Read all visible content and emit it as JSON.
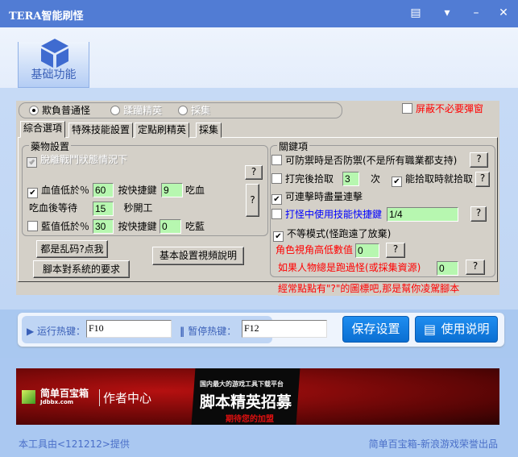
{
  "window": {
    "title": "TERA智能刷怪"
  },
  "nav": {
    "tab_label": "基础功能"
  },
  "mode": {
    "options": [
      "欺負普通怪",
      "蹂躪精英",
      "採集"
    ],
    "selected": 0,
    "block_popups_label": "屏蔽不必要彈窗",
    "block_popups_checked": false
  },
  "tabs": [
    "綜合選項",
    "特殊技能設置",
    "定點刷精英",
    "採集"
  ],
  "potion": {
    "legend": "藥物設置",
    "out_of_combat_label": "脫離戰鬥狀態情況下",
    "hp_label": "血值低於％",
    "hp_checked": true,
    "hp_value": "60",
    "hotkey_label": "按快捷鍵",
    "hp_key": "9",
    "hp_suffix": "吃血",
    "wait_label": "吃血後等待",
    "wait_value": "15",
    "wait_suffix": "秒開工",
    "mp_label": "藍值低於％",
    "mp_checked": false,
    "mp_value": "30",
    "mp_key": "0",
    "mp_suffix": "吃藍",
    "help": "?"
  },
  "buttons": {
    "garbled": "都是乱码?点我",
    "requirements": "腳本對系統的要求",
    "video": "基本設置視頻說明"
  },
  "key": {
    "legend": "關鍵項",
    "defend_label": "可防禦時是否防禦(不是所有職業都支持)",
    "defend_checked": false,
    "loot_after_label": "打完後拾取",
    "loot_after_checked": false,
    "loot_after_value": "3",
    "loot_after_unit": "次",
    "loot_asap_label": "能拾取時就拾取",
    "loot_asap_checked": true,
    "combo_label": "可連擊時盡量連擊",
    "combo_checked": true,
    "skill_key_label": "打怪中使用技能快捷鍵",
    "skill_key_checked": false,
    "skill_key_value": "1/4",
    "no_wait_label": "不等模式(怪跑遠了放棄)",
    "no_wait_checked": true,
    "camera_label": "角色視角高低數值",
    "camera_value": "0",
    "stuck_label": "如果人物總是跑過怪(或採集資源)",
    "stuck_value": "0",
    "help": "?"
  },
  "hint": "經常點點有\"?\"的圖標吧,那是幫你凌駕腳本",
  "hotkeys": {
    "run_label": "运行热键：",
    "run_value": "F10",
    "pause_label": "暂停热键：",
    "pause_value": "F12",
    "save": "保存设置",
    "manual": "使用说明"
  },
  "banner": {
    "brand": "简单百宝箱",
    "domain": "Jdbbx.com",
    "center": "作者中心",
    "line1": "国内最大的游戏工具下载平台",
    "line2": "脚本精英招募",
    "line3": "期待您的加盟"
  },
  "footer": {
    "left": "本工具由<121212>提供",
    "right": "简单百宝箱-新浪游戏荣誉出品"
  }
}
